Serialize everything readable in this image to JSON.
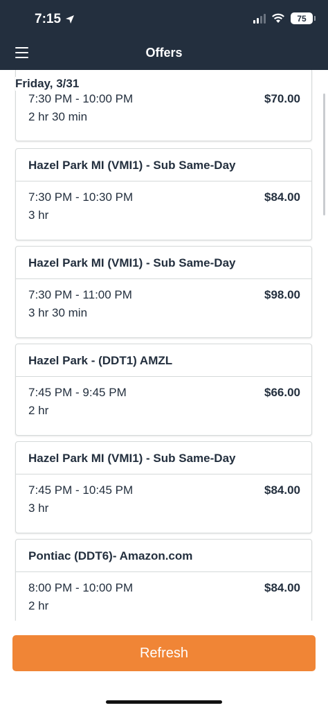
{
  "status_bar": {
    "time": "7:15",
    "battery": "75"
  },
  "header": {
    "title": "Offers"
  },
  "date_label": "Friday, 3/31",
  "first_card": {
    "time_range": "7:30 PM - 10:00 PM",
    "duration": "2 hr 30 min",
    "price": "$70.00"
  },
  "offers": [
    {
      "station": "Hazel Park MI (VMI1) - Sub Same-Day",
      "time_range": "7:30 PM - 10:30 PM",
      "duration": "3 hr",
      "price": "$84.00"
    },
    {
      "station": "Hazel Park MI (VMI1) - Sub Same-Day",
      "time_range": "7:30 PM - 11:00 PM",
      "duration": "3 hr 30 min",
      "price": "$98.00"
    },
    {
      "station": "Hazel Park - (DDT1) AMZL",
      "time_range": "7:45 PM - 9:45 PM",
      "duration": "2 hr",
      "price": "$66.00"
    },
    {
      "station": "Hazel Park MI (VMI1) - Sub Same-Day",
      "time_range": "7:45 PM - 10:45 PM",
      "duration": "3 hr",
      "price": "$84.00"
    },
    {
      "station": "Pontiac (DDT6)- Amazon.com",
      "time_range": "8:00 PM - 10:00 PM",
      "duration": "2 hr",
      "price": "$84.00"
    }
  ],
  "refresh_label": "Refresh",
  "colors": {
    "header_bg": "#232f3e",
    "refresh_bg": "#f08536",
    "card_border": "#d5d9d9"
  }
}
